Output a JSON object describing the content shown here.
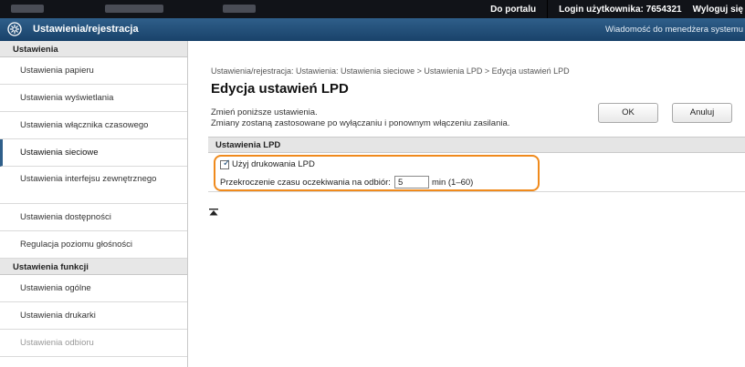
{
  "topbar": {
    "portal_link": "Do portalu",
    "login_label": "Login użytkownika:",
    "login_value": "7654321",
    "logout_link": "Wyloguj się"
  },
  "header": {
    "title": "Ustawienia/rejestracja",
    "icon": "gear-icon",
    "message_link": "Wiadomość do menedżera systemu"
  },
  "sidebar": {
    "sections": [
      {
        "label": "Ustawienia",
        "items": [
          "Ustawienia papieru",
          "Ustawienia wyświetlania",
          "Ustawienia włącznika czasowego",
          "Ustawienia sieciowe",
          "Ustawienia interfejsu zewnętrznego",
          "Ustawienia dostępności",
          "Regulacja poziomu głośności"
        ]
      },
      {
        "label": "Ustawienia funkcji",
        "items": [
          "Ustawienia ogólne",
          "Ustawienia drukarki",
          "Ustawienia odbioru"
        ]
      }
    ],
    "active_item": "Ustawienia sieciowe"
  },
  "main": {
    "breadcrumb": "Ustawienia/rejestracja: Ustawienia: Ustawienia sieciowe > Ustawienia LPD > Edycja ustawień LPD",
    "title": "Edycja ustawień LPD",
    "description_line1": "Zmień poniższe ustawienia.",
    "description_line2": "Zmiany zostaną zastosowane po wyłączaniu i ponownym włączeniu zasilania.",
    "ok_label": "OK",
    "cancel_label": "Anuluj",
    "section_title": "Ustawienia LPD",
    "use_lpd_label": "Użyj drukowania LPD",
    "use_lpd_checked": true,
    "timeout_label": "Przekroczenie czasu oczekiwania na odbiór:",
    "timeout_value": "5",
    "timeout_unit": "min (1–60)"
  },
  "colors": {
    "topbar_bg": "#111318",
    "header_bg": "#19426a",
    "highlight": "#f08a1c"
  }
}
